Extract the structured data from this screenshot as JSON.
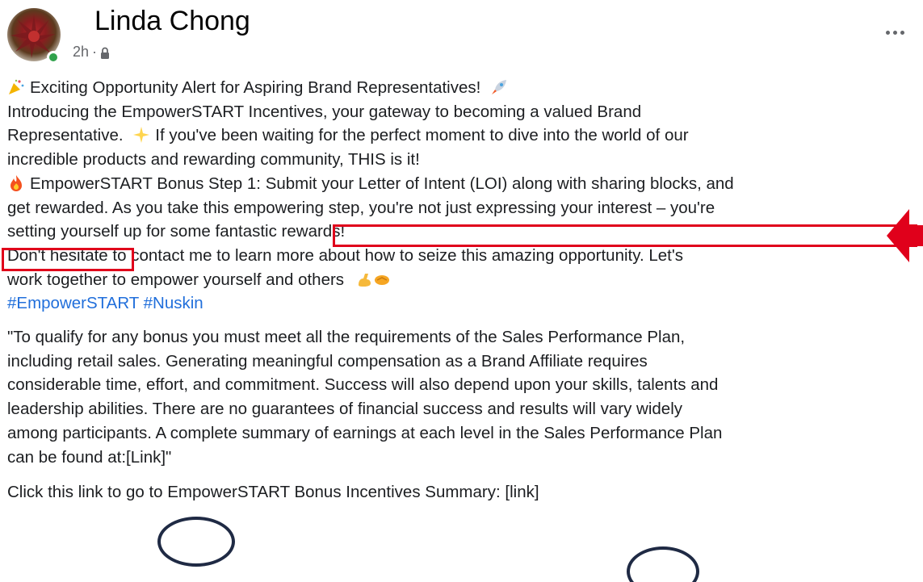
{
  "post": {
    "author": "Linda Chong",
    "time": "2h",
    "separator": "·",
    "privacy_icon": "lock-icon",
    "more_icon": "more-options-icon",
    "lines": [
      "Exciting Opportunity Alert for Aspiring Brand Representatives!",
      "Introducing the EmpowerSTART Incentives, your gateway to becoming a valued Brand",
      "Representative.",
      "If you've been waiting for the perfect moment to dive into the world of our",
      "incredible products and rewarding community, THIS is it!",
      "EmpowerSTART Bonus Step 1:",
      "Submit your Letter of Intent (LOI) along with sharing blocks, and",
      "get rewarded",
      ". As you take this empowering step, you're not just expressing your interest – you're",
      "setting yourself up for some fantastic rewards!",
      "Don't hesitate to contact me to learn more about how to seize this amazing opportunity. Let's",
      "work together to empower yourself and others"
    ],
    "hashtags": [
      "#EmpowerSTART",
      "#Nuskin"
    ],
    "disclaimer": [
      "\"To qualify for any bonus you must meet all the requirements of the Sales Performance Plan,",
      "including retail sales. Generating meaningful compensation as a Brand Affiliate requires",
      "considerable time, effort, and commitment. Success will also depend upon your skills, talents and",
      "leadership abilities. There are no guarantees of financial success and results will vary widely",
      "among participants. A complete summary of earnings at each level in the Sales Performance Plan",
      "can be found at:",
      "[Link]\""
    ],
    "cta_text": "Click this link to go to EmpowerSTART Bonus Incentives Summary:",
    "cta_link": "[link]"
  },
  "colors": {
    "highlight_box": "#e0001b",
    "circle": "#1f2a44",
    "hashtag": "#216fdb",
    "online": "#31a24c"
  }
}
